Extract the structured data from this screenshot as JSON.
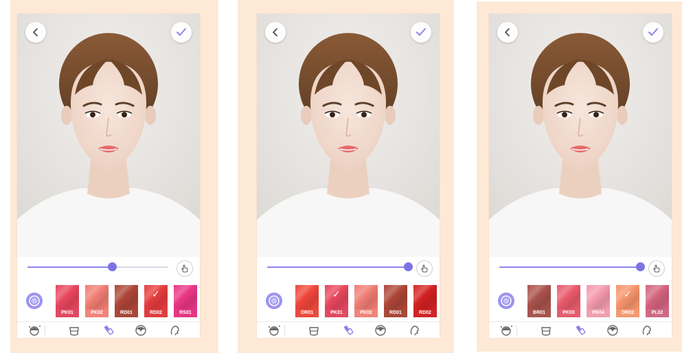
{
  "accent_color": "#8c83e8",
  "panels": [
    {
      "slider": {
        "value": 0.6
      },
      "swatches": [
        {
          "code": "PK01",
          "color": "#e8465e",
          "label_color": "#e04a62",
          "selected": false
        },
        {
          "code": "PK02",
          "color": "#f07d73",
          "label_color": "#f0847a",
          "selected": false
        },
        {
          "code": "RD01",
          "color": "#ad4637",
          "label_color": "#a8483a",
          "selected": false
        },
        {
          "code": "RD02",
          "color": "#e53c3d",
          "label_color": "#de3e3f",
          "selected": true
        },
        {
          "code": "RS01",
          "color": "#ea3585",
          "label_color": "#e43884",
          "selected": false
        }
      ]
    },
    {
      "slider": {
        "value": 1.0
      },
      "swatches": [
        {
          "code": "OR01",
          "color": "#f0463a",
          "label_color": "#ea4a3e",
          "selected": false
        },
        {
          "code": "PK01",
          "color": "#e8465e",
          "label_color": "#e04a62",
          "selected": true
        },
        {
          "code": "PK02",
          "color": "#f07d73",
          "label_color": "#f0847a",
          "selected": false
        },
        {
          "code": "RD01",
          "color": "#ad4637",
          "label_color": "#a8483a",
          "selected": false
        },
        {
          "code": "RD02",
          "color": "#d42122",
          "label_color": "#cf2526",
          "selected": false
        }
      ]
    },
    {
      "slider": {
        "value": 1.0
      },
      "swatches": [
        {
          "code": "BR01",
          "color": "#a9524b",
          "label_color": "#a3564f",
          "selected": false
        },
        {
          "code": "PK03",
          "color": "#e95a6c",
          "label_color": "#e45d6e",
          "selected": false
        },
        {
          "code": "PK04",
          "color": "#f49bae",
          "label_color": "#f09fb0",
          "selected": false
        },
        {
          "code": "OR02",
          "color": "#f6956c",
          "label_color": "#f39a72",
          "selected": true
        },
        {
          "code": "PL02",
          "color": "#d4647f",
          "label_color": "#cf6a84",
          "selected": false
        }
      ]
    }
  ]
}
